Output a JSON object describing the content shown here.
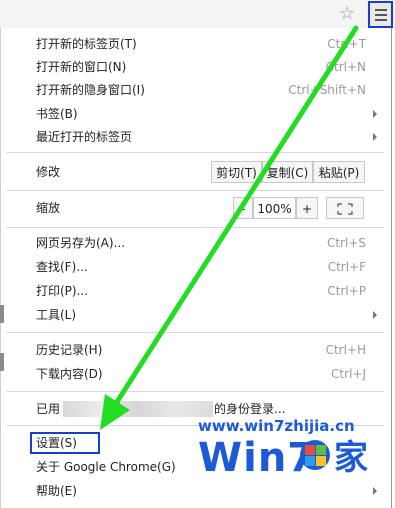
{
  "toolbar": {
    "star_icon": "star-icon",
    "menu_icon": "hamburger-icon"
  },
  "menu": {
    "new_tab": {
      "label": "打开新的标签页(T)",
      "shortcut": "Ctrl+T"
    },
    "new_window": {
      "label": "打开新的窗口(N)",
      "shortcut": "Ctrl+N"
    },
    "incognito": {
      "label": "打开新的隐身窗口(I)",
      "shortcut": "Ctrl+Shift+N"
    },
    "bookmarks": {
      "label": "书签(B)"
    },
    "recent_tabs": {
      "label": "最近打开的标签页"
    },
    "edit": {
      "label": "修改",
      "cut": "剪切(T)",
      "copy": "复制(C)",
      "paste": "粘贴(P)"
    },
    "zoom": {
      "label": "缩放",
      "minus": "-",
      "level": "100%",
      "plus": "+",
      "fullscreen_icon": "fullscreen-icon"
    },
    "save_as": {
      "label": "网页另存为(A)...",
      "shortcut": "Ctrl+S"
    },
    "find": {
      "label": "查找(F)...",
      "shortcut": "Ctrl+F"
    },
    "print": {
      "label": "打印(P)...",
      "shortcut": "Ctrl+P"
    },
    "tools": {
      "label": "工具(L)"
    },
    "history": {
      "label": "历史记录(H)",
      "shortcut": "Ctrl+H"
    },
    "downloads": {
      "label": "下载内容(D)",
      "shortcut": "Ctrl+J"
    },
    "signed_in": {
      "prefix": "已用",
      "suffix": "的身份登录..."
    },
    "settings": {
      "label": "设置(S)"
    },
    "about": {
      "label": "关于 Google Chrome(G)"
    },
    "help": {
      "label": "帮助(E)"
    }
  },
  "watermark": {
    "url": "www.win7zhijia.cn",
    "logo_text": "Win7",
    "logo_suffix": "家"
  },
  "colors": {
    "highlight_border": "#1a3dcc",
    "arrow": "#22dd22",
    "watermark": "#1d5bd6"
  }
}
